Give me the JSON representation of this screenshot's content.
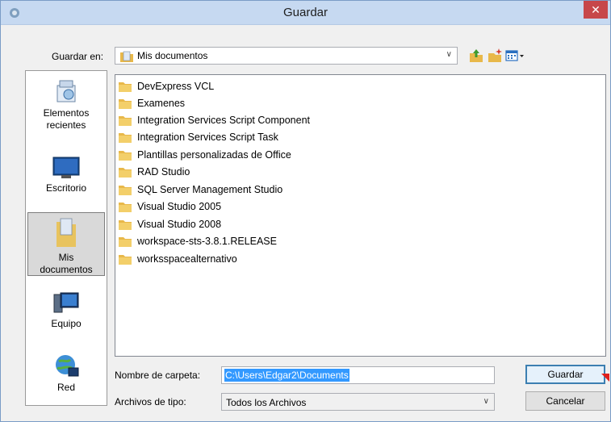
{
  "window": {
    "title": "Guardar",
    "close_label": "✕"
  },
  "lookin": {
    "label": "Guardar en:",
    "value": "Mis documentos"
  },
  "toolbar": {
    "icons": [
      "up-folder-icon",
      "new-folder-icon",
      "view-menu-icon"
    ]
  },
  "places": [
    {
      "label_line1": "Elementos",
      "label_line2": "recientes",
      "icon": "recent-items-icon"
    },
    {
      "label_line1": "Escritorio",
      "label_line2": "",
      "icon": "desktop-icon"
    },
    {
      "label_line1": "Mis",
      "label_line2": "documentos",
      "icon": "documents-icon",
      "selected": true
    },
    {
      "label_line1": "Equipo",
      "label_line2": "",
      "icon": "computer-icon"
    },
    {
      "label_line1": "Red",
      "label_line2": "",
      "icon": "network-icon"
    }
  ],
  "files": [
    {
      "name": "DevExpress VCL"
    },
    {
      "name": "Examenes"
    },
    {
      "name": "Integration Services Script Component"
    },
    {
      "name": "Integration Services Script Task"
    },
    {
      "name": "Plantillas personalizadas de Office"
    },
    {
      "name": "RAD Studio"
    },
    {
      "name": "SQL Server Management Studio"
    },
    {
      "name": "Visual Studio 2005"
    },
    {
      "name": "Visual Studio 2008"
    },
    {
      "name": "workspace-sts-3.8.1.RELEASE"
    },
    {
      "name": "worksspacealternativo"
    }
  ],
  "folder_name": {
    "label": "Nombre de carpeta:",
    "value": "C:\\Users\\Edgar2\\Documents"
  },
  "file_type": {
    "label": "Archivos de tipo:",
    "value": "Todos los Archivos"
  },
  "buttons": {
    "save": "Guardar",
    "cancel": "Cancelar"
  },
  "colors": {
    "selection": "#3399ff",
    "close": "#c7474a",
    "folder": "#e8b84a"
  }
}
